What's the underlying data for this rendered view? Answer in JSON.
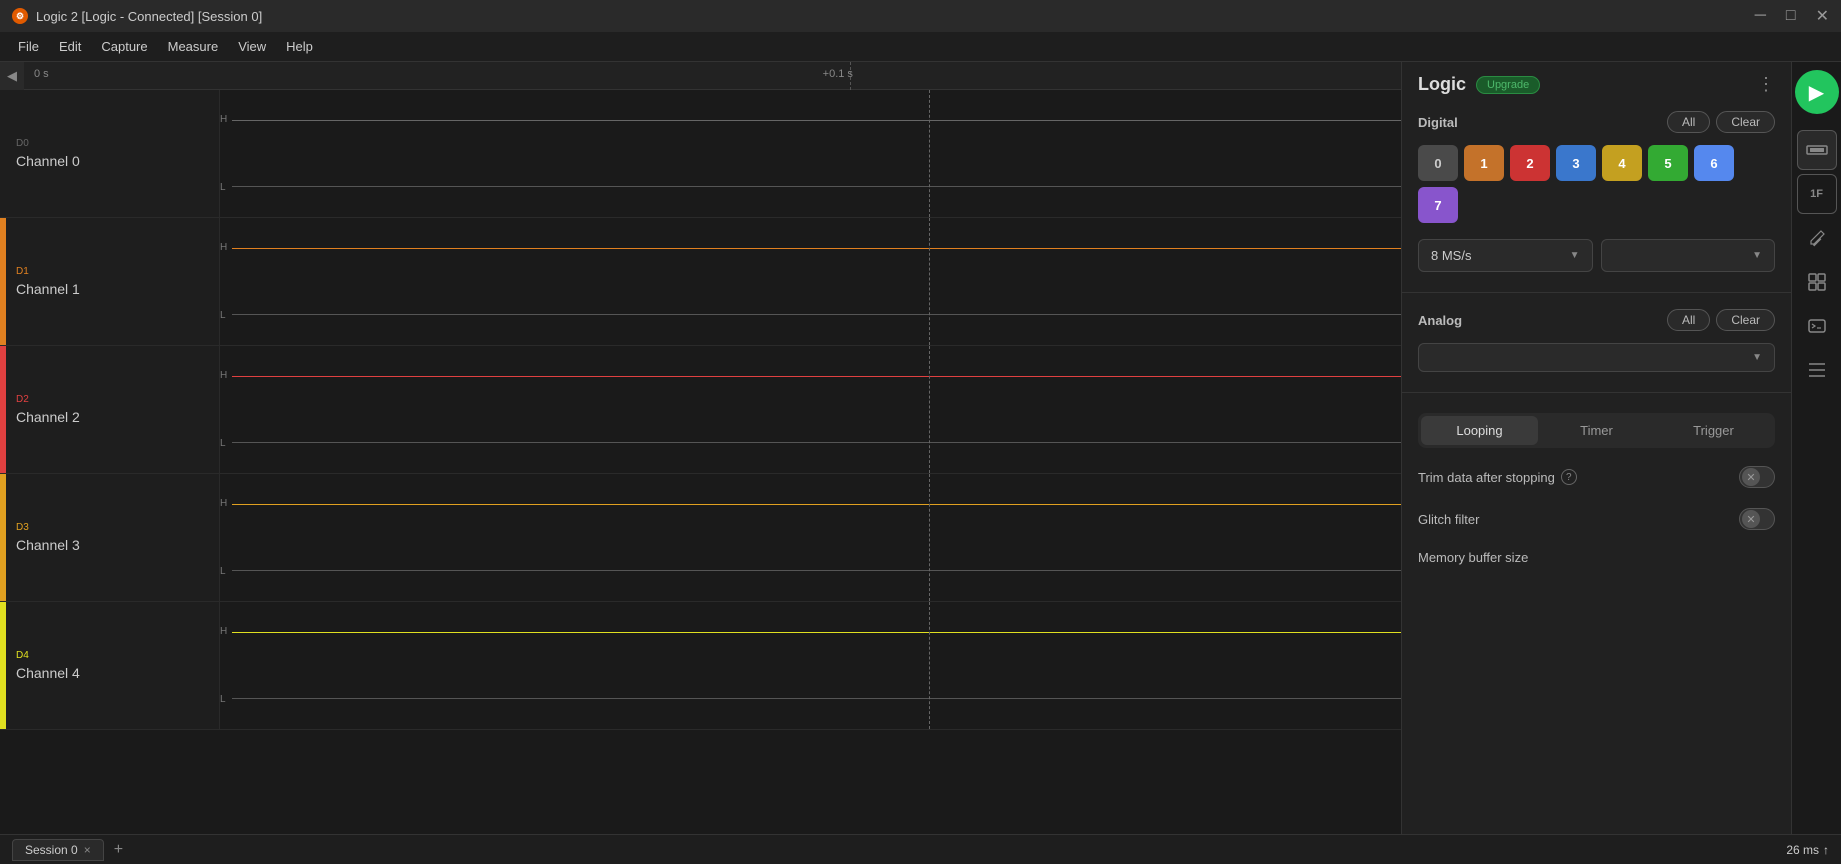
{
  "titlebar": {
    "title": "Logic 2 [Logic - Connected] [Session 0]",
    "minimize": "─",
    "maximize": "□",
    "close": "✕"
  },
  "menubar": {
    "items": [
      "File",
      "Edit",
      "Capture",
      "Measure",
      "View",
      "Help"
    ]
  },
  "ruler": {
    "start_time": "0 s",
    "mid_time": "+0.1 s"
  },
  "channels": [
    {
      "id": "D0",
      "name": "Channel 0",
      "color": "#888888",
      "indicator_color": "transparent"
    },
    {
      "id": "D1",
      "name": "Channel 1",
      "color": "#e08020",
      "indicator_color": "#e08020"
    },
    {
      "id": "D2",
      "name": "Channel 2",
      "color": "#e04040",
      "indicator_color": "#e04040"
    },
    {
      "id": "D3",
      "name": "Channel 3",
      "color": "#e0a020",
      "indicator_color": "#e0a020"
    },
    {
      "id": "D4",
      "name": "Channel 4",
      "color": "#e0e020",
      "indicator_color": "#e0e020"
    }
  ],
  "panel": {
    "title": "Logic",
    "upgrade_label": "Upgrade",
    "menu_icon": "⋮",
    "digital": {
      "title": "Digital",
      "all_btn": "All",
      "clear_btn": "Clear",
      "channels": [
        {
          "num": "0",
          "color": "#4a4a4a"
        },
        {
          "num": "1",
          "color": "#c4722a"
        },
        {
          "num": "2",
          "color": "#cc3333"
        },
        {
          "num": "3",
          "color": "#3a77cc"
        },
        {
          "num": "4",
          "color": "#c4a020"
        },
        {
          "num": "5",
          "color": "#33aa33"
        },
        {
          "num": "6",
          "color": "#5588ee"
        },
        {
          "num": "7",
          "color": "#8855cc"
        }
      ],
      "sample_rate": "8 MS/s"
    },
    "analog": {
      "title": "Analog",
      "all_btn": "All",
      "clear_btn": "Clear",
      "placeholder": ""
    },
    "tabs": [
      "Looping",
      "Timer",
      "Trigger"
    ],
    "active_tab": 0,
    "trim_data": {
      "label": "Trim data after stopping",
      "help": "?"
    },
    "glitch_filter": {
      "label": "Glitch filter"
    },
    "memory_buffer": {
      "label": "Memory buffer size"
    }
  },
  "bottom_bar": {
    "session_label": "Session 0",
    "close_icon": "×",
    "add_icon": "+",
    "time_display": "26 ms",
    "time_arrow": "↑"
  }
}
